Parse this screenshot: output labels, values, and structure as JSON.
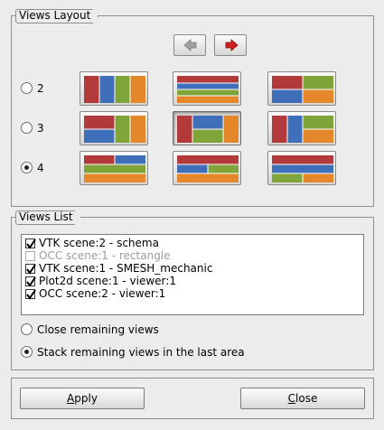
{
  "views_layout": {
    "title": "Views Layout",
    "prev_icon": "left-arrow-icon",
    "next_icon": "right-arrow-icon",
    "rows": [
      {
        "label": "2",
        "selected": false
      },
      {
        "label": "3",
        "selected": false
      },
      {
        "label": "4",
        "selected": true
      }
    ],
    "selected_layout": "3-row-2"
  },
  "views_list": {
    "title": "Views List",
    "items": [
      {
        "text": "VTK scene:2 - schema",
        "checked": true,
        "enabled": true
      },
      {
        "text": "OCC scene:1 - rectangle",
        "checked": false,
        "enabled": false
      },
      {
        "text": "VTK scene:1 - SMESH_mechanic",
        "checked": true,
        "enabled": true
      },
      {
        "text": "Plot2d scene:1 - viewer:1",
        "checked": true,
        "enabled": true
      },
      {
        "text": "OCC scene:2 - viewer:1",
        "checked": true,
        "enabled": true
      }
    ],
    "options": [
      {
        "label": "Close remaining views",
        "selected": false
      },
      {
        "label": "Stack remaining views in the last area",
        "selected": true
      }
    ]
  },
  "buttons": {
    "apply_mnemonic": "A",
    "apply_rest": "pply",
    "close_mnemonic": "C",
    "close_rest": "lose"
  },
  "colors": {
    "red": "#b33a3a",
    "blue": "#3f6fb8",
    "green": "#7fa43a",
    "orange": "#e3872a",
    "arrow_red": "#d22020",
    "arrow_grey": "#a0a0a0"
  }
}
